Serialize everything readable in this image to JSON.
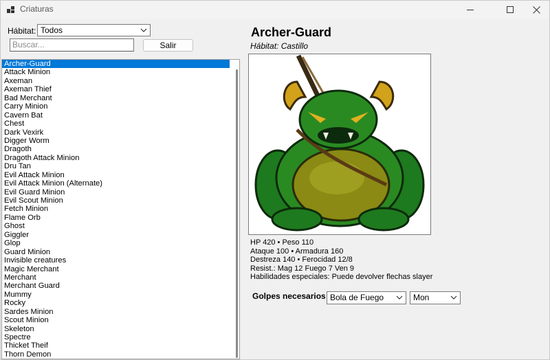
{
  "window": {
    "title": "Criaturas"
  },
  "filters": {
    "habitat_label": "Hábitat:",
    "habitat_value": "Todos",
    "search_placeholder": "Buscar...",
    "exit_label": "Salir"
  },
  "creatures": [
    "Archer-Guard",
    "Attack Minion",
    "Axeman",
    "Axeman Thief",
    "Bad Merchant",
    "Carry Minion",
    "Cavern Bat",
    "Chest",
    "Dark Vexirk",
    "Digger Worm",
    "Dragoth",
    "Dragoth Attack Minion",
    "Dru Tan",
    "Evil Attack Minion",
    "Evil Attack Minion (Alternate)",
    "Evil Guard Minion",
    "Evil Scout Minion",
    "Fetch Minion",
    "Flame Orb",
    "Ghost",
    "Giggler",
    "Glop",
    "Guard Minion",
    "Invisible creatures",
    "Magic Merchant",
    "Merchant",
    "Merchant Guard",
    "Mummy",
    "Rocky",
    "Sardes Minion",
    "Scout Minion",
    "Skeleton",
    "Spectre",
    "Thicket Theif",
    "Thorn Demon"
  ],
  "selected_index": 0,
  "detail": {
    "name": "Archer-Guard",
    "habitat": "Hábitat: Castillo",
    "stats_line1": "HP 420  •  Peso 110",
    "stats_line2": "Ataque 100  •  Armadura 160",
    "stats_line3": "Destreza 140  •  Ferocidad 12/8",
    "stats_line4": "Resist.: Mag 12  Fuego 7  Ven 9",
    "stats_line5": "Habilidades especiales: Puede devolver flechas slayer",
    "golpes_label": "Golpes necesarios",
    "spell_value": "Bola de Fuego",
    "power_value": "Mon"
  },
  "colors": {
    "selection": "#0078d7",
    "window_bg": "#f0f0f0"
  }
}
